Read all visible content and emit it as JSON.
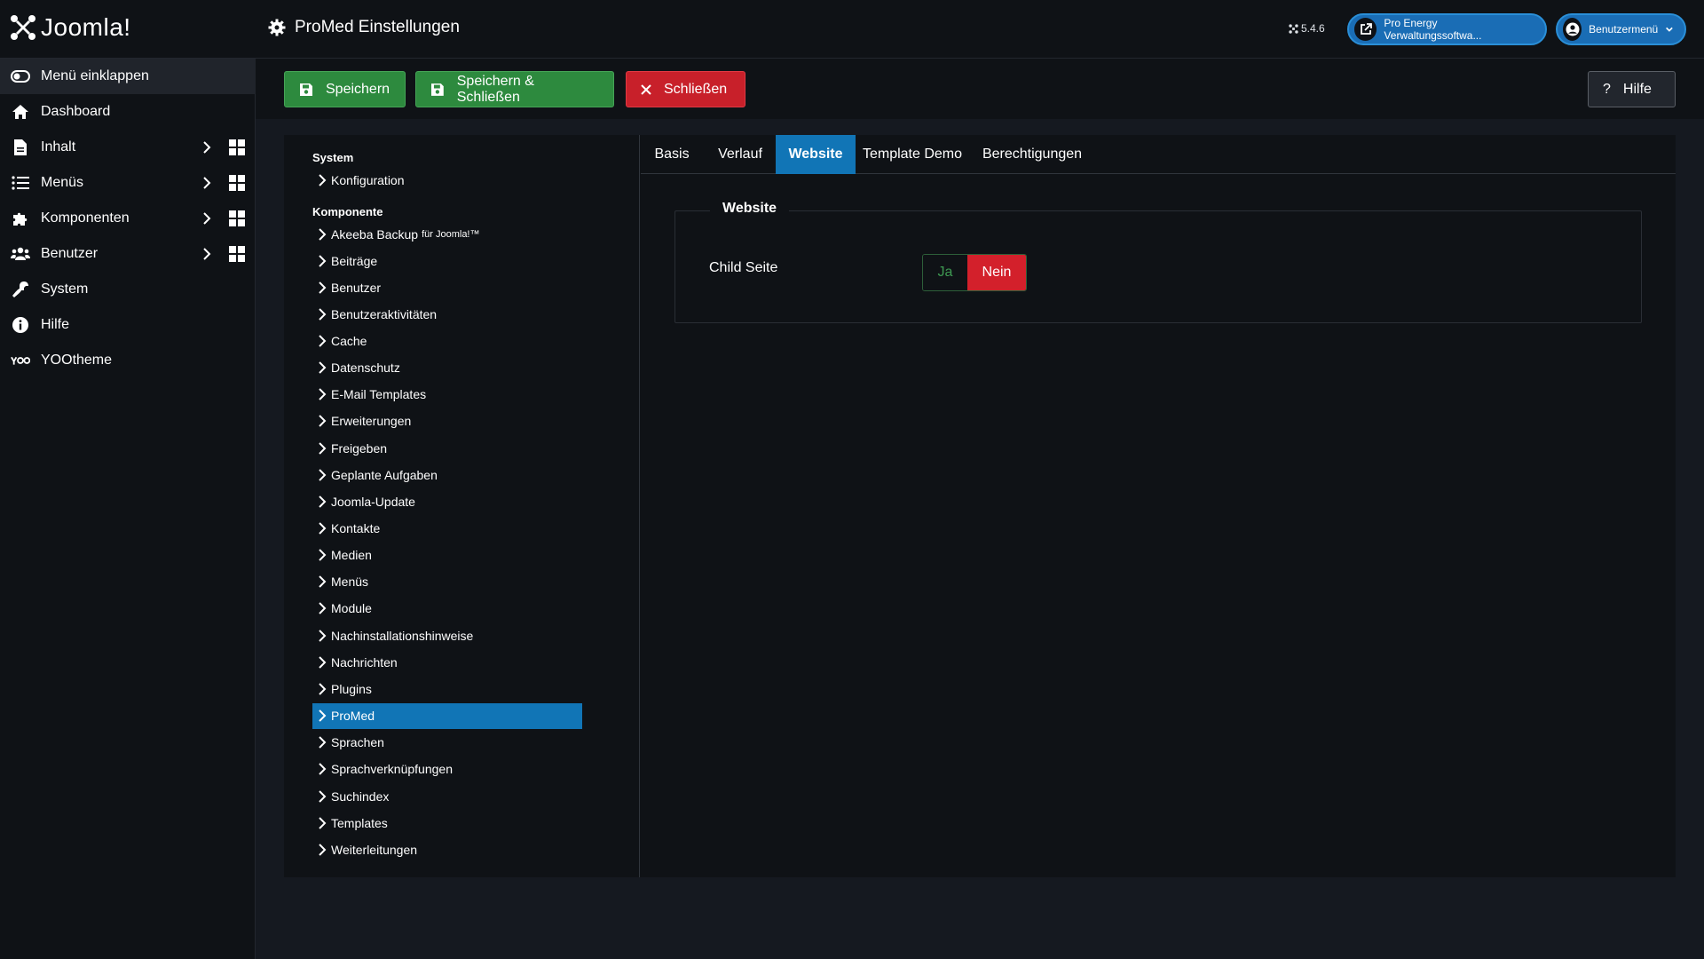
{
  "header": {
    "brand": "Joomla!",
    "page_title": "ProMed Einstellungen",
    "version": "5.4.6",
    "site_link": "Pro Energy Verwaltungssoftwa...",
    "user_menu": "Benutzermenü"
  },
  "sidebar": {
    "items": [
      {
        "label": "Menü einklappen"
      },
      {
        "label": "Dashboard"
      },
      {
        "label": "Inhalt"
      },
      {
        "label": "Menüs"
      },
      {
        "label": "Komponenten"
      },
      {
        "label": "Benutzer"
      },
      {
        "label": "System"
      },
      {
        "label": "Hilfe"
      },
      {
        "label": "YOOtheme"
      }
    ]
  },
  "toolbar": {
    "save": "Speichern",
    "save_close": "Speichern & Schließen",
    "close": "Schließen",
    "help": "Hilfe"
  },
  "tree": {
    "system_heading": "System",
    "system_items": [
      "Konfiguration"
    ],
    "component_heading": "Komponente",
    "akeeba_main": "Akeeba Backup",
    "akeeba_suffix": "für Joomla!™",
    "component_items": [
      "Beiträge",
      "Benutzer",
      "Benutzeraktivitäten",
      "Cache",
      "Datenschutz",
      "E-Mail Templates",
      "Erweiterungen",
      "Freigeben",
      "Geplante Aufgaben",
      "Joomla-Update",
      "Kontakte",
      "Medien",
      "Menüs",
      "Module",
      "Nachinstallationshinweise",
      "Nachrichten",
      "Plugins",
      "ProMed",
      "Sprachen",
      "Sprachverknüpfungen",
      "Suchindex",
      "Templates",
      "Weiterleitungen"
    ],
    "active": "ProMed"
  },
  "tabs": [
    "Basis",
    "Verlauf",
    "Website",
    "Template Demo",
    "Berechtigungen"
  ],
  "active_tab": "Website",
  "form": {
    "legend": "Website",
    "field_label": "Child Seite",
    "option_yes": "Ja",
    "option_no": "Nein",
    "selected": "Nein"
  },
  "colors": {
    "accent": "#1175b6",
    "save": "#2d8a3e",
    "close": "#c8202a",
    "background": "#151920",
    "panel": "#0f1216"
  }
}
